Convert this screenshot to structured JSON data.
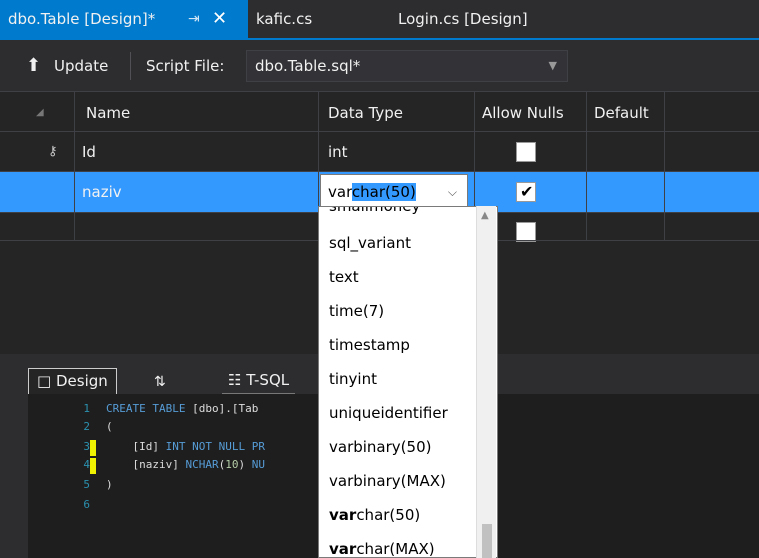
{
  "tabs": {
    "active_label": "dbo.Table [Design]*",
    "tab2_label": "kafic.cs",
    "tab3_label": "Login.cs [Design]"
  },
  "toolbar": {
    "update_label": "Update",
    "script_file_label": "Script File:",
    "script_file_value": "dbo.Table.sql*"
  },
  "grid": {
    "headers": {
      "name": "Name",
      "data_type": "Data Type",
      "allow_nulls": "Allow Nulls",
      "default": "Default"
    },
    "rows": [
      {
        "name": "Id",
        "data_type": "int",
        "allow_nulls": false,
        "is_key": true
      },
      {
        "name": "naziv",
        "data_type": "varchar(50)",
        "allow_nulls": true,
        "is_key": false
      },
      {
        "name": "",
        "data_type": "",
        "allow_nulls": false,
        "is_key": false
      }
    ],
    "edit_typed": "var",
    "edit_completion": "char(50)"
  },
  "dropdown": {
    "items": [
      {
        "label": "smallmoney",
        "match": ""
      },
      {
        "label": "sql_variant",
        "match": ""
      },
      {
        "label": "text",
        "match": ""
      },
      {
        "label": "time(7)",
        "match": ""
      },
      {
        "label": "timestamp",
        "match": ""
      },
      {
        "label": "tinyint",
        "match": ""
      },
      {
        "label": "uniqueidentifier",
        "match": ""
      },
      {
        "label": "varbinary(50)",
        "match": ""
      },
      {
        "label": "varbinary(MAX)",
        "match": ""
      },
      {
        "label": "char(50)",
        "match": "var"
      },
      {
        "label": "char(MAX)",
        "match": "var"
      }
    ]
  },
  "bottom_tabs": {
    "design_label": "Design",
    "swap_label": "⇅",
    "tsql_label": "T-SQL"
  },
  "code": {
    "lines": [
      {
        "n": "1",
        "text": "CREATE TABLE [dbo].[Tab"
      },
      {
        "n": "2",
        "text": "("
      },
      {
        "n": "3",
        "text": "    [Id] INT NOT NULL PR"
      },
      {
        "n": "4",
        "text": "    [naziv] NCHAR(10) NU"
      },
      {
        "n": "5",
        "text": ")"
      },
      {
        "n": "6",
        "text": ""
      }
    ]
  },
  "colors": {
    "accent": "#007acc",
    "selection": "#3399ff"
  }
}
